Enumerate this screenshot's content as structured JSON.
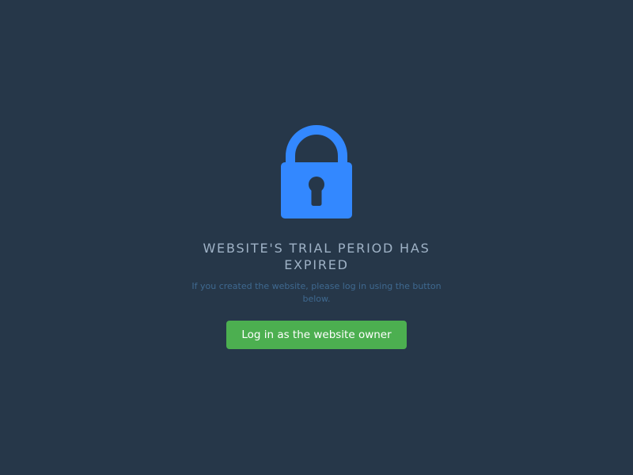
{
  "colors": {
    "background": "#263749",
    "lock": "#3388ff",
    "title": "#9fb2c6",
    "description": "#3f6990",
    "button_bg": "#4caf50",
    "button_text": "#ffffff"
  },
  "icon": "lock-icon",
  "heading": {
    "line1": "WEBSITE'S TRIAL PERIOD HAS",
    "line2": "EXPIRED"
  },
  "description": {
    "line1": "If you created the website, please log in using the button",
    "line2": "below."
  },
  "login_button": {
    "label": "Log in as the website owner"
  }
}
